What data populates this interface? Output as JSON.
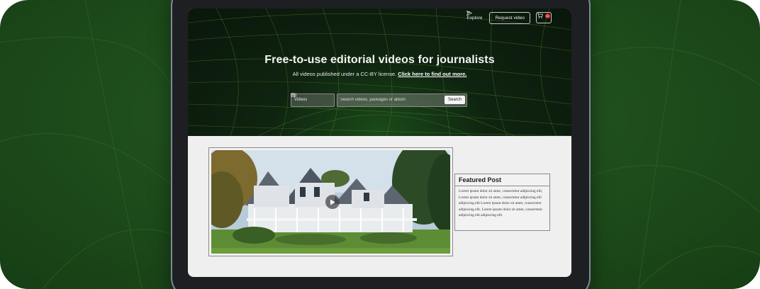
{
  "nav": {
    "explore_label": "Explore",
    "request_label": "Request video",
    "cart_count": "01"
  },
  "hero": {
    "title": "Free-to-use editorial videos for journalists",
    "subtitle": "All videos published under a CC-BY license.",
    "link_text": "Click here to find out more."
  },
  "search": {
    "type_selected": "Videos",
    "placeholder": "Search videos, packages or album",
    "button_label": "Search"
  },
  "featured": {
    "title": "Featured Post",
    "body": "Lorem ipsum dolor sit amet, consectetur adipiscing elit, Lorem ipsum dolor sit amet, consectetur adipiscing elit adipiscing elit Lorem ipsum dolor sit amet, consectetur adipiscing elit. Lorem ipsum dolor sit amet, consectetur adipiscing elit adipiscing elit"
  },
  "colors": {
    "background_green": "#1f4f1c",
    "hero_dark": "#0a160b",
    "cart_badge": "#e0282f"
  }
}
